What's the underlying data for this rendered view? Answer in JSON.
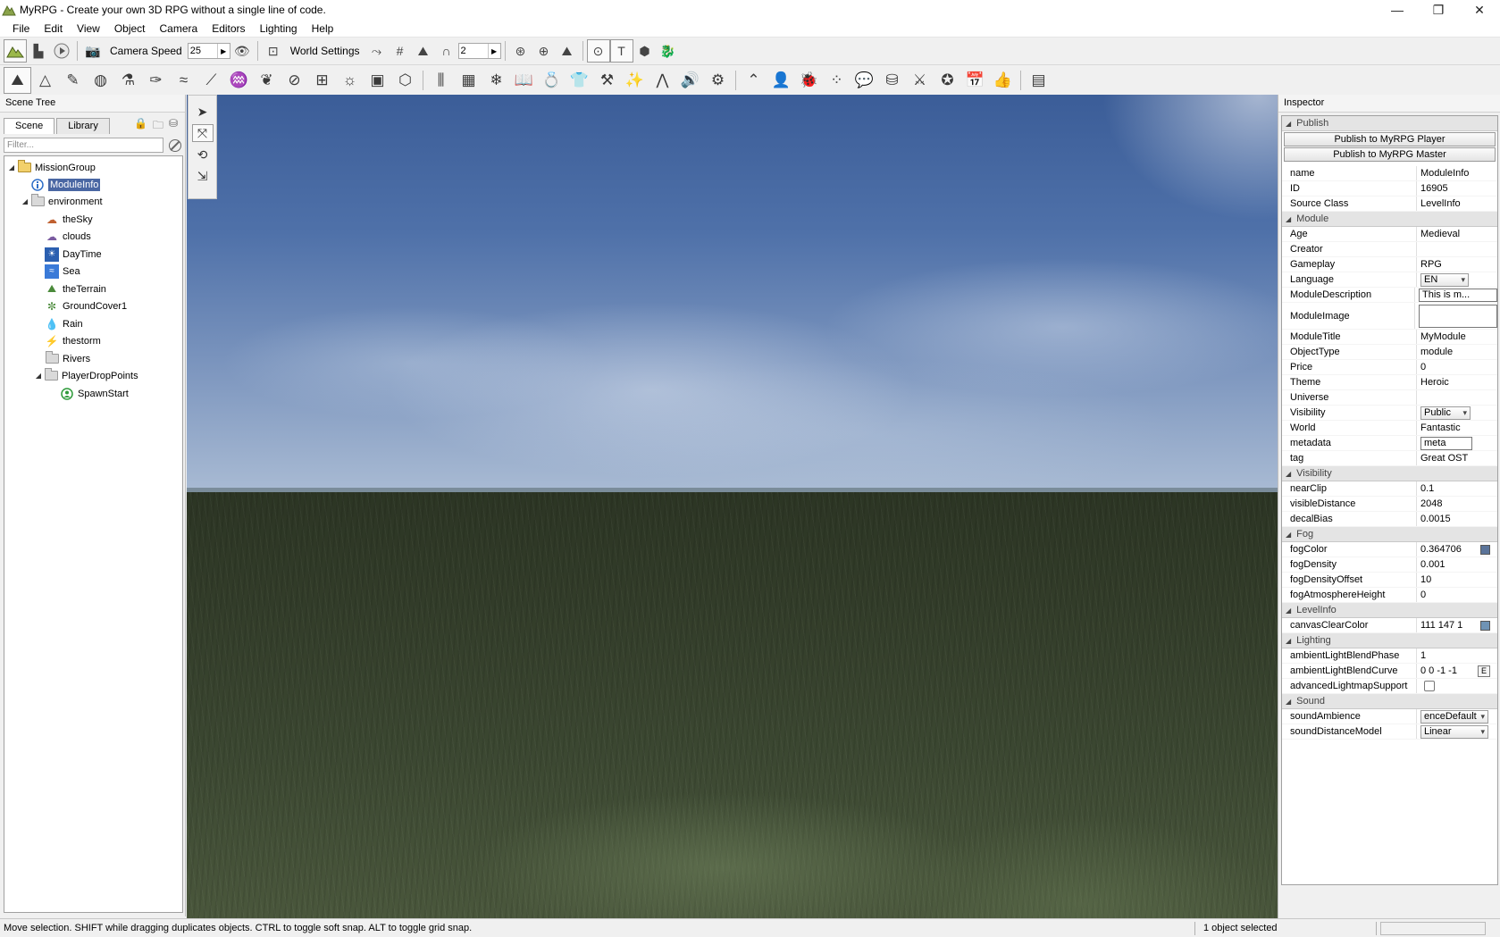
{
  "window": {
    "title": "MyRPG - Create your own 3D RPG without a single line of code.",
    "minimize": "—",
    "maximize": "❐",
    "close": "✕"
  },
  "menu": [
    "File",
    "Edit",
    "View",
    "Object",
    "Camera",
    "Editors",
    "Lighting",
    "Help"
  ],
  "toolbar": {
    "camera_speed_label": "Camera Speed",
    "camera_speed_value": "25",
    "world_settings_label": "World Settings",
    "grid_value": "2"
  },
  "scene_tree": {
    "header": "Scene Tree",
    "tabs": [
      "Scene",
      "Library"
    ],
    "filter_placeholder": "Filter...",
    "items": [
      {
        "label": "MissionGroup",
        "icon": "folder-open-icon"
      },
      {
        "label": "ModuleInfo",
        "icon": "info-icon"
      },
      {
        "label": "environment",
        "icon": "folder-icon"
      },
      {
        "label": "theSky",
        "icon": "sky-icon"
      },
      {
        "label": "clouds",
        "icon": "clouds-icon"
      },
      {
        "label": "DayTime",
        "icon": "daytime-icon"
      },
      {
        "label": "Sea",
        "icon": "sea-icon"
      },
      {
        "label": "theTerrain",
        "icon": "terrain-icon"
      },
      {
        "label": "GroundCover1",
        "icon": "groundcover-icon"
      },
      {
        "label": "Rain",
        "icon": "rain-icon"
      },
      {
        "label": "thestorm",
        "icon": "storm-icon"
      },
      {
        "label": "Rivers",
        "icon": "folder-icon"
      },
      {
        "label": "PlayerDropPoints",
        "icon": "folder-icon"
      },
      {
        "label": "SpawnStart",
        "icon": "spawn-icon"
      }
    ]
  },
  "inspector": {
    "header": "Inspector",
    "sections": {
      "publish": "Publish",
      "module": "Module",
      "visibility": "Visibility",
      "fog": "Fog",
      "levelinfo": "LevelInfo",
      "lighting": "Lighting",
      "sound": "Sound"
    },
    "publish_player": "Publish to MyRPG Player",
    "publish_master": "Publish to MyRPG Master",
    "props": {
      "name": {
        "label": "name",
        "value": "ModuleInfo"
      },
      "id": {
        "label": "ID",
        "value": "16905"
      },
      "source_class": {
        "label": "Source Class",
        "value": "LevelInfo"
      },
      "age": {
        "label": "Age",
        "value": "Medieval"
      },
      "creator": {
        "label": "Creator",
        "value": ""
      },
      "gameplay": {
        "label": "Gameplay",
        "value": "RPG"
      },
      "language": {
        "label": "Language",
        "value": "EN"
      },
      "module_description": {
        "label": "ModuleDescription",
        "value": "This is m..."
      },
      "module_image": {
        "label": "ModuleImage",
        "value": ""
      },
      "module_title": {
        "label": "ModuleTitle",
        "value": "MyModule"
      },
      "object_type": {
        "label": "ObjectType",
        "value": "module"
      },
      "price": {
        "label": "Price",
        "value": "0"
      },
      "theme": {
        "label": "Theme",
        "value": "Heroic"
      },
      "universe": {
        "label": "Universe",
        "value": ""
      },
      "visibility": {
        "label": "Visibility",
        "value": "Public"
      },
      "world": {
        "label": "World",
        "value": "Fantastic"
      },
      "metadata": {
        "label": "metadata",
        "value": "meta"
      },
      "tag": {
        "label": "tag",
        "value": "Great OST"
      },
      "near_clip": {
        "label": "nearClip",
        "value": "0.1"
      },
      "visible_distance": {
        "label": "visibleDistance",
        "value": "2048"
      },
      "decal_bias": {
        "label": "decalBias",
        "value": "0.0015"
      },
      "fog_color": {
        "label": "fogColor",
        "value": "0.364706",
        "swatch": "#5a7399"
      },
      "fog_density": {
        "label": "fogDensity",
        "value": "0.001"
      },
      "fog_density_offset": {
        "label": "fogDensityOffset",
        "value": "10"
      },
      "fog_atmosphere_height": {
        "label": "fogAtmosphereHeight",
        "value": "0"
      },
      "canvas_clear_color": {
        "label": "canvasClearColor",
        "value": "111 147 1",
        "swatch": "#6f93b5"
      },
      "ambient_light_blend_phase": {
        "label": "ambientLightBlendPhase",
        "value": "1"
      },
      "ambient_light_blend_curve": {
        "label": "ambientLightBlendCurve",
        "value": "0 0 -1 -1",
        "button": "E"
      },
      "advanced_lightmap_support": {
        "label": "advancedLightmapSupport",
        "checked": false
      },
      "sound_ambience": {
        "label": "soundAmbience",
        "value": "enceDefault"
      },
      "sound_distance_model": {
        "label": "soundDistanceModel",
        "value": "Linear"
      }
    }
  },
  "status": {
    "message": "Move selection.  SHIFT while dragging duplicates objects.  CTRL to toggle soft snap.  ALT to toggle grid snap.",
    "selection": "1 object selected"
  }
}
